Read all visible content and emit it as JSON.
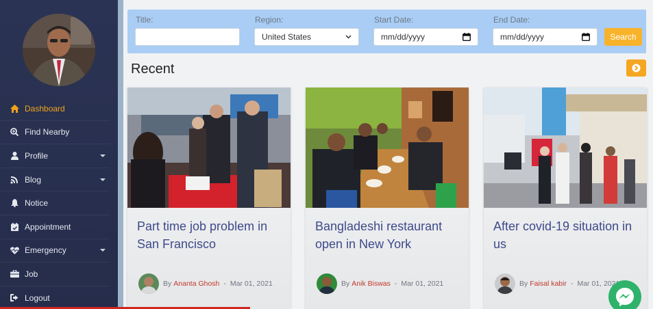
{
  "sidebar": {
    "items": [
      {
        "label": "Dashboard",
        "icon": "home-icon",
        "active": true
      },
      {
        "label": "Find Nearby",
        "icon": "search-plus-icon"
      },
      {
        "label": "Profile",
        "icon": "user-icon",
        "has_submenu": true
      },
      {
        "label": "Blog",
        "icon": "blog-icon",
        "has_submenu": true
      },
      {
        "label": "Notice",
        "icon": "bell-icon"
      },
      {
        "label": "Appointment",
        "icon": "calendar-check-icon"
      },
      {
        "label": "Emergency",
        "icon": "heart-pulse-icon",
        "has_submenu": true
      },
      {
        "label": "Job",
        "icon": "briefcase-icon"
      },
      {
        "label": "Logout",
        "icon": "sign-out-icon"
      }
    ]
  },
  "filter": {
    "title_label": "Title:",
    "title_value": "",
    "region_label": "Region:",
    "region_value": "United States",
    "start_label": "Start Date:",
    "start_value": "mm/dd/yyyy",
    "end_label": "End Date:",
    "end_value": "mm/dd/yyyy",
    "search_label": "Search"
  },
  "recent": {
    "heading": "Recent"
  },
  "cards": [
    {
      "title": "Part time job problem in San Francisco",
      "by": "By",
      "author": "Ananta Ghosh",
      "sep": "-",
      "date": "Mar 01, 2021"
    },
    {
      "title": "Bangladeshi restaurant open in New York",
      "by": "By",
      "author": "Anik Biswas",
      "sep": "-",
      "date": "Mar 01, 2021"
    },
    {
      "title": "After covid-19 situation in us",
      "by": "By",
      "author": "Faisal kabir",
      "sep": "-",
      "date": "Mar 01, 2021"
    }
  ],
  "colors": {
    "accent": "#f0a21a",
    "sidebar": "#2b3354",
    "title": "#3d4a8a",
    "author": "#c0392b"
  }
}
